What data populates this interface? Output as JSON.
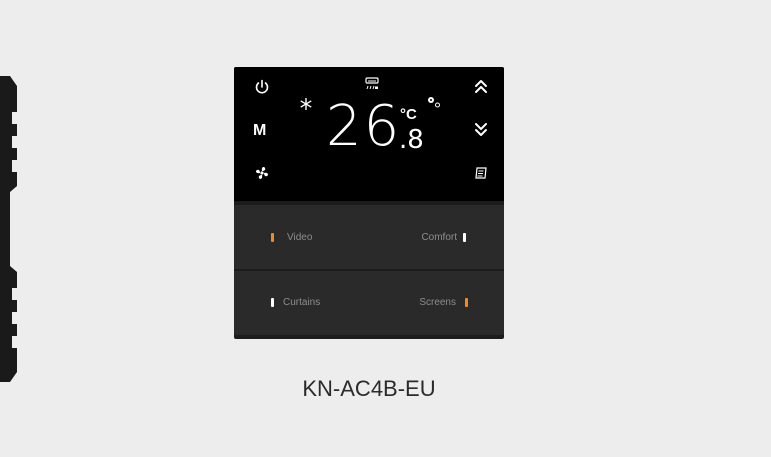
{
  "display": {
    "temperature_integer": "26",
    "temperature_decimal": ".8",
    "unit": "°C",
    "mode_label": "M",
    "icons": [
      "power-icon",
      "mode-icon",
      "fan-icon",
      "snowflake-icon",
      "ac-icon",
      "fan-speed-icon",
      "chevron-up-icon",
      "chevron-down-icon",
      "schedule-icon"
    ]
  },
  "buttons": {
    "video": "Video",
    "comfort": "Comfort",
    "curtains": "Curtains",
    "screens": "Screens"
  },
  "colors": {
    "led_orange": "#f28a1c",
    "led_white": "#ffffff",
    "panel": "#1c1c1c"
  },
  "product": {
    "model": "KN-AC4B-EU"
  }
}
